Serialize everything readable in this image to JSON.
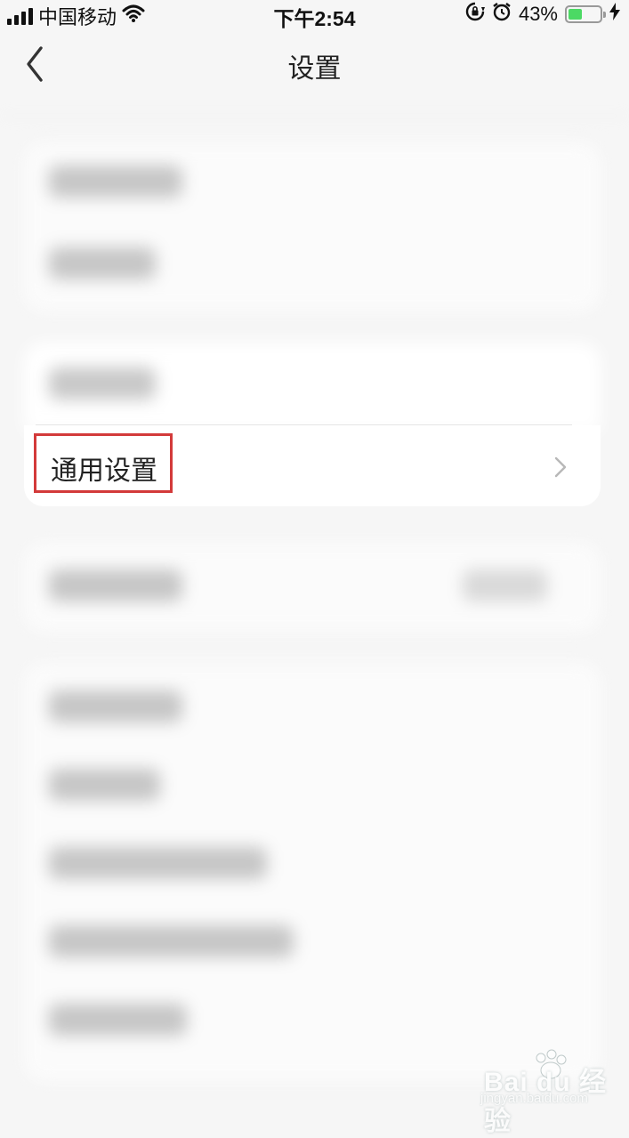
{
  "status_bar": {
    "carrier": "中国移动",
    "time": "下午2:54",
    "battery_percent": "43%",
    "battery_level": 0.43,
    "icons": [
      "signal-icon",
      "wifi-icon",
      "rotation-lock-icon",
      "alarm-icon",
      "battery-icon",
      "charging-icon"
    ]
  },
  "nav": {
    "title": "设置",
    "back_icon": "chevron-left-icon"
  },
  "settings": {
    "highlighted_item": {
      "label": "通用设置",
      "icon": "chevron-right-icon"
    }
  },
  "colors": {
    "highlight_border": "#d33a3a",
    "battery_fill": "#4cd964"
  }
}
